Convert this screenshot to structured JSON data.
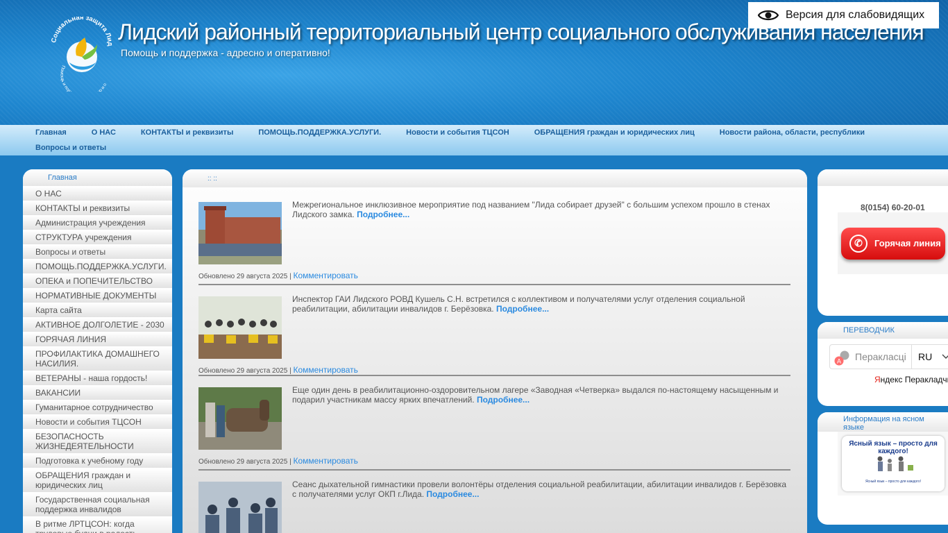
{
  "header": {
    "title": "Лидский районный территориальный центр социального обслуживания населения",
    "slogan": "Помощь и поддержка - адресно и оперативно!",
    "low_vision_label": "Версия для слабовидящих",
    "logo_top_text": "Социальная защита Лидчины",
    "logo_bottom_text": "Помощь и поддержка - адресно и оперативно!"
  },
  "topnav": {
    "row1": [
      "Главная",
      "О НАС",
      "КОНТАКТЫ и реквизиты",
      "ПОМОЩЬ.ПОДДЕРЖКА.УСЛУГИ.",
      "Новости и события ТЦСОН",
      "ОБРАЩЕНИЯ граждан и юридических лиц",
      "Новости района, области, республики"
    ],
    "row2": [
      "Вопросы и ответы"
    ]
  },
  "left": {
    "head": "Главная",
    "items": [
      "О НАС",
      "КОНТАКТЫ и реквизиты",
      "Администрация учреждения",
      "СТРУКТУРА учреждения",
      "Вопросы и ответы",
      "ПОМОЩЬ.ПОДДЕРЖКА.УСЛУГИ.",
      "ОПЕКА и ПОПЕЧИТЕЛЬСТВО",
      "НОРМАТИВНЫЕ ДОКУМЕНТЫ",
      "Карта сайта",
      "АКТИВНОЕ ДОЛГОЛЕТИЕ - 2030",
      "ГОРЯЧАЯ ЛИНИЯ",
      "ПРОФИЛАКТИКА ДОМАШНЕГО НАСИЛИЯ.",
      "ВЕТЕРАНЫ - наша гордость!",
      "ВАКАНСИИ",
      "Гуманитарное сотрудничество",
      "Новости и события ТЦСОН",
      "БЕЗОПАСНОСТЬ ЖИЗНЕДЕЯТЕЛЬНОСТИ",
      "Подготовка к учебному году",
      "ОБРАЩЕНИЯ граждан и юридических лиц",
      "Государственная социальная поддержка инвалидов",
      "В ритме ЛРТЦСОН: когда трудовые будни в радость"
    ]
  },
  "center": {
    "head": ":: ::",
    "more_label": "Подробнее...",
    "comment_label": "Комментировать",
    "news": [
      {
        "text": "Межрегиональное инклюзивное мероприятие под названием \"Лида собирает друзей\" с большим успехом прошло в стенах Лидского замка.",
        "updated": "Обновлено 29 августа 2025 |"
      },
      {
        "text": "Инспектор ГАИ Лидского РОВД Кушель С.Н. встретился с коллективом и получателями услуг отделения социальной реабилитации, абилитации инвалидов г. Берёзовка.",
        "updated": "Обновлено 29 августа 2025 |"
      },
      {
        "text": "Еще один день в реабилитационно-оздоровительном лагере «Заводная «Четверка» выдался по-настоящему насыщенным и подарил участникам массу ярких впечатлений.",
        "updated": "Обновлено 29 августа 2025 |"
      },
      {
        "text": "Сеанс дыхательной гимнастики провели волонтёры отделения социальной реабилитации, абилитации инвалидов г. Берёзовка с получателями услуг ОКП г.Лида.",
        "updated": ""
      }
    ]
  },
  "right": {
    "phone": "8(0154) 60-20-01",
    "hotline_label": "Горячая линия",
    "translator_head": "ПЕРЕВОДЧИК",
    "translator_placeholder": "Перакласці",
    "translator_lang": "RU",
    "yandex_first": "Я",
    "yandex_rest": "ндекс Перакладчык",
    "clear_head": "Информация на ясном языке",
    "clear_banner_title": "Ясный язык – просто для каждого!",
    "clear_banner_sub": "Ясный язык – просто для каждого!"
  },
  "colors": {
    "link": "#2a8ae0",
    "nav_text": "#1a5f9c",
    "hotline": "#e01818",
    "header_blue": "#1e86cf"
  }
}
